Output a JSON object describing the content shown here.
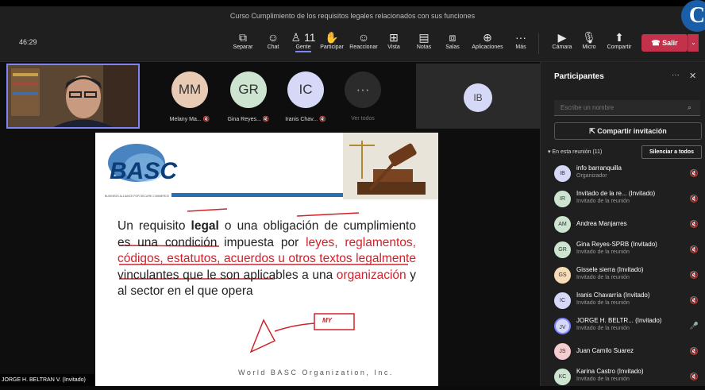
{
  "window": {
    "title": "Curso Cumplimiento de los requisitos legales relacionados con sus funciones",
    "timer": "46:29"
  },
  "toolbar": {
    "items": [
      {
        "label": "Separar",
        "icon": "⧉"
      },
      {
        "label": "Chat",
        "icon": "☺"
      },
      {
        "label": "Gente",
        "icon": "♙",
        "count": "11"
      },
      {
        "label": "Participar",
        "icon": "✋"
      },
      {
        "label": "Reaccionar",
        "icon": "☺"
      },
      {
        "label": "Vista",
        "icon": "⊞"
      },
      {
        "label": "Notas",
        "icon": "▤"
      },
      {
        "label": "Salas",
        "icon": "⧈"
      },
      {
        "label": "Aplicaciones",
        "icon": "⊕"
      },
      {
        "label": "Más",
        "icon": "···"
      }
    ],
    "camera": "Cámara",
    "mic": "Micro",
    "share": "Compartir",
    "leave": "Salir"
  },
  "stage": {
    "tiles": [
      {
        "initials": "MM",
        "name": "Melany Ma...",
        "color": "#e9cbb5"
      },
      {
        "initials": "GR",
        "name": "Gina Reyes...",
        "color": "#cde5d0"
      },
      {
        "initials": "IC",
        "name": "Iranis Chav...",
        "color": "#d6d8f7"
      }
    ],
    "see_all": "Ver todos",
    "ib_initials": "IB",
    "presenter_name": "JORGE H. BELTRAN V. (Invitado)"
  },
  "slide": {
    "logo_text": "BASC",
    "logo_sub": "BUSINESS ALLIANCE FOR SECURE COMMERCE",
    "sentence_1": "Un requisito",
    "bold_word": "legal",
    "sentence_2": "o una obligación de cumplimiento es una condición impuesta por",
    "red_1": "leyes, reglamentos, códigos, estatutos, acuerdos u otros textos legalmente",
    "sentence_3": "vinculantes que le son aplicables a una",
    "red_2": "organización",
    "sentence_4": "y al sector en el que opera",
    "annotation": "MY",
    "footer": "World BASC Organization, Inc."
  },
  "sidebar": {
    "title": "Participantes",
    "search_placeholder": "Escribe un nombre",
    "share_invite": "Compartir invitación",
    "in_meeting": "En esta reunión (11)",
    "mute_all": "Silenciar a todos",
    "people": [
      {
        "initials": "IB",
        "name": "info barranquilla",
        "role": "Organizador",
        "color": "#d6d8f7"
      },
      {
        "initials": "IR",
        "name": "Invitado de la re...  (Invitado)",
        "role": "Invitado de la reunión",
        "color": "#cde5d0"
      },
      {
        "initials": "AM",
        "name": "Andrea Manjarres",
        "role": "",
        "color": "#cde5d0"
      },
      {
        "initials": "GR",
        "name": "Gina Reyes-SPRB (Invitado)",
        "role": "Invitado de la reunión",
        "color": "#cde5d0"
      },
      {
        "initials": "GS",
        "name": "Gissele sierra (Invitado)",
        "role": "Invitado de la reunión",
        "color": "#f6dcb8"
      },
      {
        "initials": "IC",
        "name": "Iranis Chavarría (Invitado)",
        "role": "Invitado de la reunión",
        "color": "#d6d8f7"
      },
      {
        "initials": "JV",
        "name": "JORGE H. BELTR...  (Invitado)",
        "role": "Invitado de la reunión",
        "color": "#d6d8f7"
      },
      {
        "initials": "JS",
        "name": "Juan Camilo Suarez",
        "role": "",
        "color": "#f5cccf"
      },
      {
        "initials": "KC",
        "name": "Karina Castro (Invitado)",
        "role": "Invitado de la reunión",
        "color": "#cde5d0"
      }
    ]
  }
}
